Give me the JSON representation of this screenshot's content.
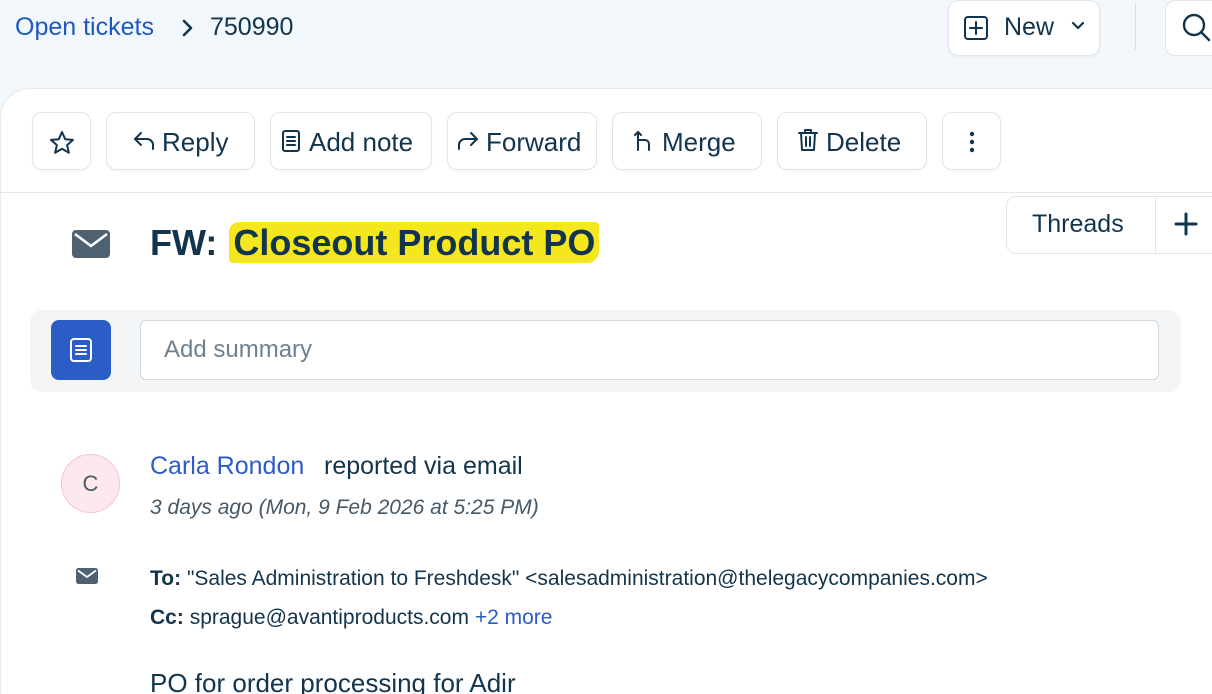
{
  "breadcrumb": {
    "parent": "Open tickets",
    "current": "750990"
  },
  "header": {
    "new_label": "New"
  },
  "toolbar": {
    "reply": "Reply",
    "add_note": "Add note",
    "forward": "Forward",
    "merge": "Merge",
    "delete": "Delete"
  },
  "threads": {
    "label": "Threads"
  },
  "ticket": {
    "subject_prefix": "FW:",
    "subject_highlight": "Closeout Product PO"
  },
  "summary": {
    "placeholder": "Add summary"
  },
  "message": {
    "avatar_initial": "C",
    "sender": "Carla Rondon",
    "action": "reported via email",
    "timestamp": "3 days ago (Mon, 9 Feb 2026 at 5:25 PM)",
    "to_label": "To:",
    "to_value": "\"Sales Administration to Freshdesk\" <salesadministration@thelegacycompanies.com>",
    "cc_label": "Cc:",
    "cc_value": "sprague@avantiproducts.com",
    "cc_more": "+2 more",
    "body": "PO for order processing for Adir"
  },
  "colors": {
    "accent": "#2c5cc5",
    "link": "#1f57c3",
    "highlight": "#f5e71d",
    "text": "#12344d",
    "avatar_bg": "#fde9ed"
  },
  "icons": [
    "chevron-right-icon",
    "plus-square-icon",
    "chevron-down-icon",
    "search-icon",
    "star-icon",
    "reply-icon",
    "note-icon",
    "forward-icon",
    "merge-icon",
    "trash-icon",
    "more-vertical-icon",
    "plus-icon",
    "envelope-icon",
    "document-icon"
  ]
}
